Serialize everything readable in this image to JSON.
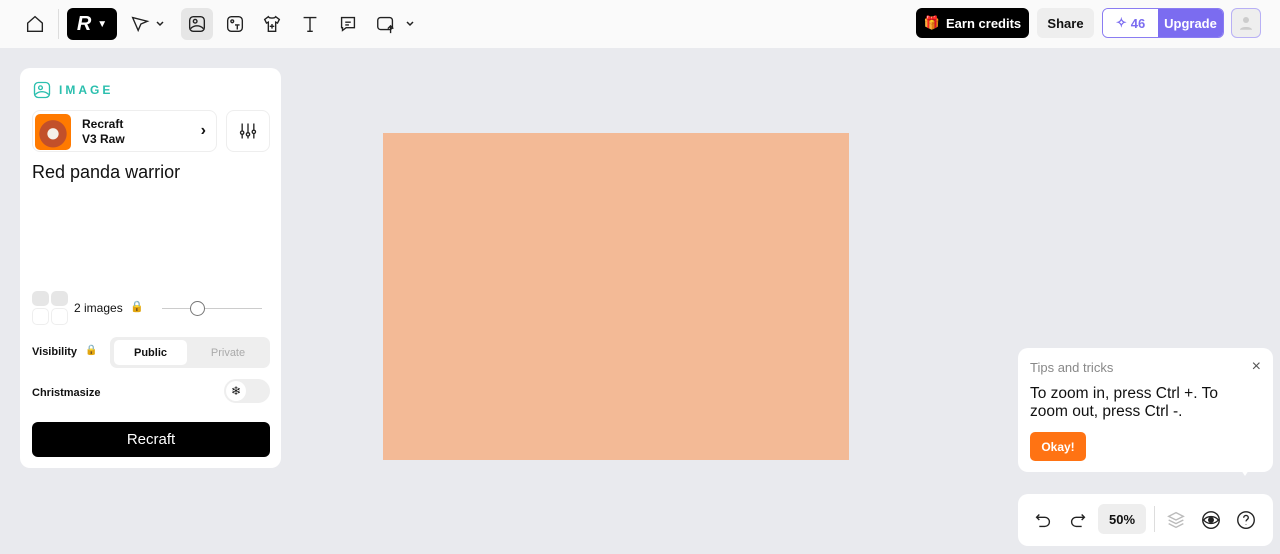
{
  "toolbar": {
    "earn_credits": "Earn credits",
    "share": "Share",
    "credits": "46",
    "upgrade": "Upgrade"
  },
  "panel": {
    "section": "IMAGE",
    "model_line1": "Recraft",
    "model_line2": "V3 Raw",
    "prompt": "Red panda warrior",
    "images_count": "2 images",
    "images_slider_fraction": 0.35,
    "visibility_label": "Visibility",
    "public": "Public",
    "private": "Private",
    "visibility_selected": "Public",
    "christmasize": "Christmasize",
    "christmasize_on": false,
    "recraft_button": "Recraft"
  },
  "canvas": {
    "color": "#f3ba96"
  },
  "tips": {
    "title": "Tips and tricks",
    "body": "To zoom in, press Ctrl +. To zoom out, press Ctrl -.",
    "okay": "Okay!"
  },
  "zoom": {
    "level": "50%"
  },
  "colors": {
    "accent": "#7b6cf0",
    "teal": "#2bbfae",
    "orange": "#ff7313"
  }
}
